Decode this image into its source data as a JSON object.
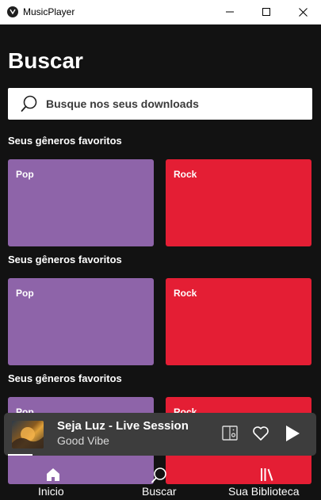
{
  "window": {
    "title": "MusicPlayer"
  },
  "page": {
    "title": "Buscar"
  },
  "search": {
    "placeholder": "Busque nos seus downloads"
  },
  "sections": [
    {
      "heading": "Seus gêneros favoritos",
      "genres": [
        "Pop",
        "Rock"
      ]
    },
    {
      "heading": "Seus gêneros favoritos",
      "genres": [
        "Pop",
        "Rock"
      ]
    },
    {
      "heading": "Seus gêneros favoritos",
      "genres": [
        "Pop",
        "Rock"
      ]
    }
  ],
  "genre_colors": {
    "pop": "#8e64a9",
    "rock": "#e41e34"
  },
  "now_playing": {
    "title": "Seja Luz - Live Session",
    "artist": "Good Vibe",
    "progress": 0.08,
    "icons": [
      "devices-icon",
      "heart-icon",
      "play-icon"
    ]
  },
  "nav": {
    "items": [
      {
        "label": "Inicio",
        "icon": "home-icon"
      },
      {
        "label": "Buscar",
        "icon": "search-icon"
      },
      {
        "label": "Sua Biblioteca",
        "icon": "library-icon"
      }
    ]
  }
}
